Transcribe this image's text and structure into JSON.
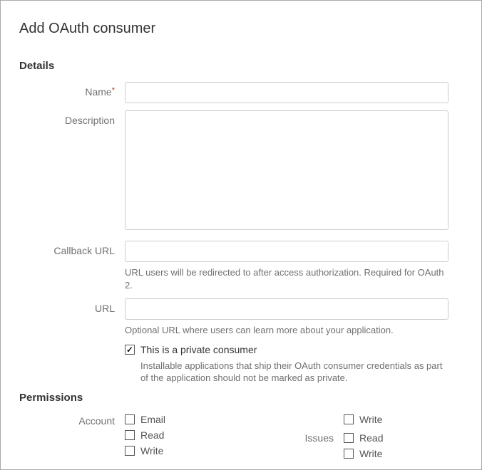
{
  "title": "Add OAuth consumer",
  "sections": {
    "details": "Details",
    "permissions": "Permissions"
  },
  "fields": {
    "name": {
      "label": "Name",
      "value": ""
    },
    "description": {
      "label": "Description",
      "value": ""
    },
    "callback": {
      "label": "Callback URL",
      "value": "",
      "help": "URL users will be redirected to after access authorization. Required for OAuth 2."
    },
    "url": {
      "label": "URL",
      "value": "",
      "help": "Optional URL where users can learn more about your application."
    },
    "private": {
      "label": "This is a private consumer",
      "checked": true,
      "help": "Installable applications that ship their OAuth consumer credentials as part of the application should not be marked as private."
    }
  },
  "permissions": {
    "group1_label": "Account",
    "group1": {
      "email": {
        "label": "Email",
        "checked": false
      },
      "read": {
        "label": "Read",
        "checked": false
      },
      "write": {
        "label": "Write",
        "checked": false
      }
    },
    "right_top": {
      "write": {
        "label": "Write",
        "checked": false
      }
    },
    "group2_label": "Issues",
    "group2": {
      "read": {
        "label": "Read",
        "checked": false
      },
      "write": {
        "label": "Write",
        "checked": false
      }
    }
  }
}
